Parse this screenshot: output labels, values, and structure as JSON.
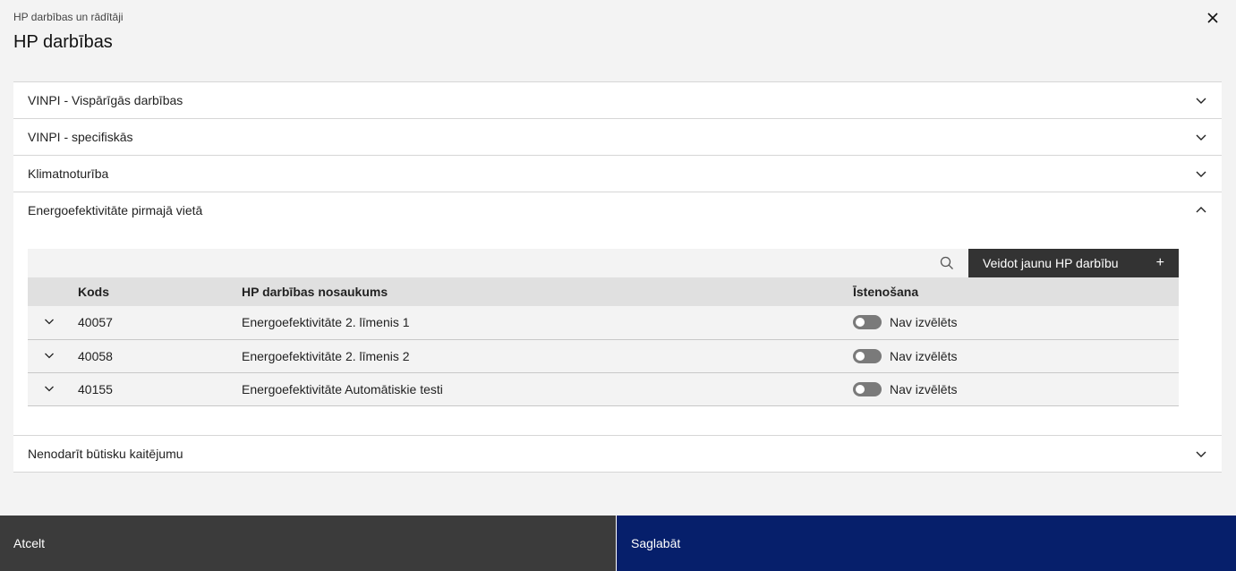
{
  "header": {
    "breadcrumb": "HP darbības un rādītāji",
    "title": "HP darbības"
  },
  "accordion": {
    "sections": [
      {
        "label": "VINPI - Vispārīgās darbības",
        "expanded": false
      },
      {
        "label": "VINPI - specifiskās",
        "expanded": false
      },
      {
        "label": "Klimatnoturība",
        "expanded": false
      },
      {
        "label": "Energoefektivitāte pirmajā vietā",
        "expanded": true
      },
      {
        "label": "Nenodarīt būtisku kaitējumu",
        "expanded": false
      }
    ]
  },
  "table": {
    "new_button": "Veidot jaunu HP darbību",
    "new_button_icon": "+",
    "headers": {
      "code": "Kods",
      "name": "HP darbības nosaukums",
      "implementation": "Īstenošana"
    },
    "rows": [
      {
        "code": "40057",
        "name": "Energoefektivitāte 2. līmenis 1",
        "status": "Nav izvēlēts"
      },
      {
        "code": "40058",
        "name": "Energoefektivitāte 2. līmenis 2",
        "status": "Nav izvēlēts"
      },
      {
        "code": "40155",
        "name": "Energoefektivitāte Automātiskie testi",
        "status": "Nav izvēlēts"
      }
    ]
  },
  "footer": {
    "cancel": "Atcelt",
    "save": "Saglabāt"
  },
  "colors": {
    "save_bg": "#061f6b",
    "cancel_bg": "#3b3b3b",
    "new_button_bg": "#333333"
  }
}
